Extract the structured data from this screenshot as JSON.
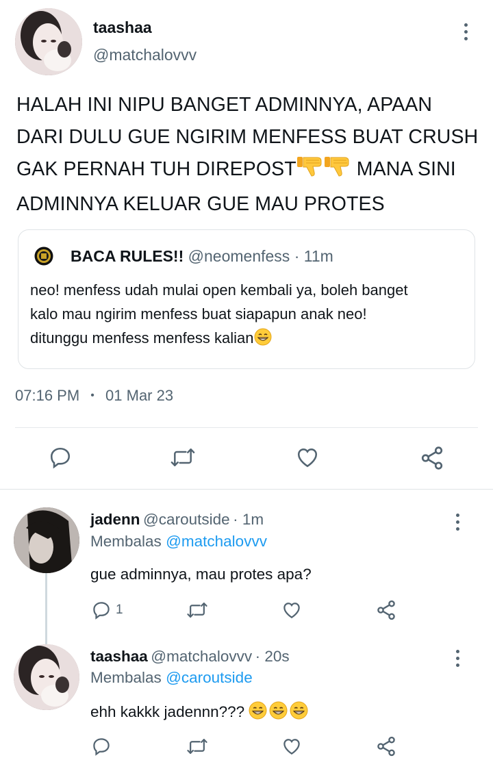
{
  "main_tweet": {
    "name": "taashaa",
    "handle": "@matchalovvv",
    "text_line1": "HALAH INI NIPU BANGET ADMINNYA, APAAN",
    "text_line2": "DARI DULU GUE NGIRIM MENFESS BUAT CRUSH",
    "text_line3a": "GAK PERNAH TUH DIREPOST",
    "text_line3b": " MANA SINI",
    "text_line4": "ADMINNYA KELUAR GUE MAU PROTES",
    "emojis": [
      "thumbs-down",
      "thumbs-down"
    ],
    "quote": {
      "name": "BACA RULES!!",
      "handle": "@neomenfess",
      "time": "· 11m",
      "line1": "neo! menfess udah mulai open kembali ya, boleh banget",
      "line2": "kalo mau ngirim menfess buat siapapun anak neo!",
      "line3": "ditunggu menfess menfess kalian"
    },
    "time": "07:16 PM",
    "dot": "•",
    "date": "01 Mar 23"
  },
  "replies": [
    {
      "name": "jadenn",
      "handle": "@caroutside",
      "time": "· 1m",
      "replying_prefix": "Membalas",
      "replying_to": "@matchalovvv",
      "text": "gue adminnya, mau protes apa?",
      "reply_count": "1"
    },
    {
      "name": "taashaa",
      "handle": "@matchalovvv",
      "time": "· 20s",
      "replying_prefix": "Membalas",
      "replying_to": "@caroutside",
      "text": "ehh kakkk jadennn???",
      "reply_count": ""
    }
  ],
  "colors": {
    "link": "#1d9bf0",
    "secondary": "#536471",
    "border": "#dfe3e6"
  }
}
